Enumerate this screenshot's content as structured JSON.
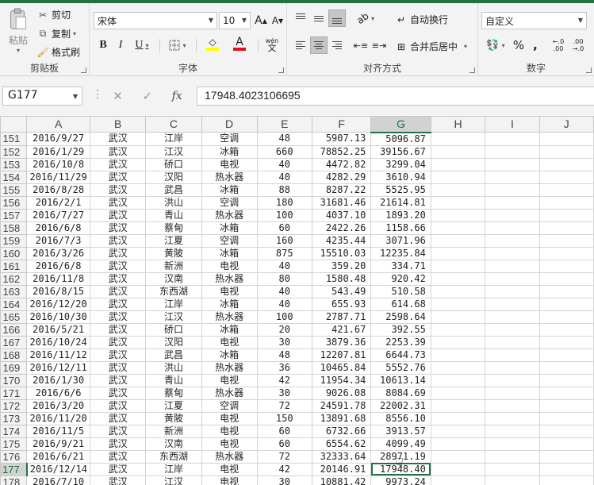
{
  "colors": {
    "accent": "#217346",
    "ribbon_bg": "#f3f3f3",
    "font_color_bar": "#e81123",
    "fill_color_bar": "#ffff00"
  },
  "ribbon": {
    "clipboard": {
      "label": "剪贴板",
      "paste": "粘贴",
      "cut": "剪切",
      "copy": "复制",
      "format_painter": "格式刷"
    },
    "font": {
      "label": "字体",
      "font_name": "宋体",
      "font_size": "10",
      "bold": "B",
      "italic": "I",
      "underline": "U",
      "grow": "A",
      "shrink": "A",
      "phonetic_top": "wén",
      "phonetic_bottom": "文",
      "font_color_glyph": "A"
    },
    "alignment": {
      "label": "对齐方式",
      "wrap_text": "自动换行",
      "merge_center": "合并后居中"
    },
    "number": {
      "label": "数字",
      "format": "自定义",
      "percent": "%",
      "comma": ",",
      "inc_decimal_top": "←.0",
      "inc_decimal_bottom": ".00",
      "dec_decimal_top": ".00",
      "dec_decimal_bottom": "→.0"
    }
  },
  "formula_bar": {
    "name_box": "G177",
    "separator": "⋮",
    "cancel": "✕",
    "enter": "✓",
    "fx": "fx",
    "value": "17948.4023106695"
  },
  "columns": [
    "A",
    "B",
    "C",
    "D",
    "E",
    "F",
    "G",
    "H",
    "I",
    "J"
  ],
  "selected_column": "G",
  "selected_row": "177",
  "rows": [
    [
      "151",
      "2016/9/27",
      "武汉",
      "江岸",
      "空调",
      "48",
      "5907.13",
      "5096.87"
    ],
    [
      "152",
      "2016/1/29",
      "武汉",
      "江汉",
      "冰箱",
      "660",
      "78852.25",
      "39156.67"
    ],
    [
      "153",
      "2016/10/8",
      "武汉",
      "硚口",
      "电视",
      "40",
      "4472.82",
      "3299.04"
    ],
    [
      "154",
      "2016/11/29",
      "武汉",
      "汉阳",
      "热水器",
      "40",
      "4282.29",
      "3610.94"
    ],
    [
      "155",
      "2016/8/28",
      "武汉",
      "武昌",
      "冰箱",
      "88",
      "8287.22",
      "5525.95"
    ],
    [
      "156",
      "2016/2/1",
      "武汉",
      "洪山",
      "空调",
      "180",
      "31681.46",
      "21614.81"
    ],
    [
      "157",
      "2016/7/27",
      "武汉",
      "青山",
      "热水器",
      "100",
      "4037.10",
      "1893.20"
    ],
    [
      "158",
      "2016/6/8",
      "武汉",
      "蔡甸",
      "冰箱",
      "60",
      "2422.26",
      "1158.66"
    ],
    [
      "159",
      "2016/7/3",
      "武汉",
      "江夏",
      "空调",
      "160",
      "4235.44",
      "3071.96"
    ],
    [
      "160",
      "2016/3/26",
      "武汉",
      "黄陂",
      "冰箱",
      "875",
      "15510.03",
      "12235.84"
    ],
    [
      "161",
      "2016/6/8",
      "武汉",
      "新洲",
      "电视",
      "40",
      "359.20",
      "334.71"
    ],
    [
      "162",
      "2016/11/8",
      "武汉",
      "汉南",
      "热水器",
      "80",
      "1580.48",
      "920.42"
    ],
    [
      "163",
      "2016/8/15",
      "武汉",
      "东西湖",
      "电视",
      "40",
      "543.49",
      "510.58"
    ],
    [
      "164",
      "2016/12/20",
      "武汉",
      "江岸",
      "冰箱",
      "40",
      "655.93",
      "614.68"
    ],
    [
      "165",
      "2016/10/30",
      "武汉",
      "江汉",
      "热水器",
      "100",
      "2787.71",
      "2598.64"
    ],
    [
      "166",
      "2016/5/21",
      "武汉",
      "硚口",
      "冰箱",
      "20",
      "421.67",
      "392.55"
    ],
    [
      "167",
      "2016/10/24",
      "武汉",
      "汉阳",
      "电视",
      "30",
      "3879.36",
      "2253.39"
    ],
    [
      "168",
      "2016/11/12",
      "武汉",
      "武昌",
      "冰箱",
      "48",
      "12207.81",
      "6644.73"
    ],
    [
      "169",
      "2016/12/11",
      "武汉",
      "洪山",
      "热水器",
      "36",
      "10465.84",
      "5552.76"
    ],
    [
      "170",
      "2016/1/30",
      "武汉",
      "青山",
      "电视",
      "42",
      "11954.34",
      "10613.14"
    ],
    [
      "171",
      "2016/6/6",
      "武汉",
      "蔡甸",
      "热水器",
      "30",
      "9026.08",
      "8084.69"
    ],
    [
      "172",
      "2016/3/20",
      "武汉",
      "江夏",
      "空调",
      "72",
      "24591.78",
      "22002.31"
    ],
    [
      "173",
      "2016/11/20",
      "武汉",
      "黄陂",
      "电视",
      "150",
      "13891.68",
      "8556.10"
    ],
    [
      "174",
      "2016/11/5",
      "武汉",
      "新洲",
      "电视",
      "60",
      "6732.66",
      "3913.57"
    ],
    [
      "175",
      "2016/9/21",
      "武汉",
      "汉南",
      "电视",
      "60",
      "6554.62",
      "4099.49"
    ],
    [
      "176",
      "2016/6/21",
      "武汉",
      "东西湖",
      "热水器",
      "72",
      "32333.64",
      "28971.19"
    ],
    [
      "177",
      "2016/12/14",
      "武汉",
      "江岸",
      "电视",
      "42",
      "20146.91",
      "17948.40"
    ],
    [
      "178",
      "2016/7/10",
      "武汉",
      "江汉",
      "电视",
      "30",
      "10881.42",
      "9973.24"
    ]
  ]
}
